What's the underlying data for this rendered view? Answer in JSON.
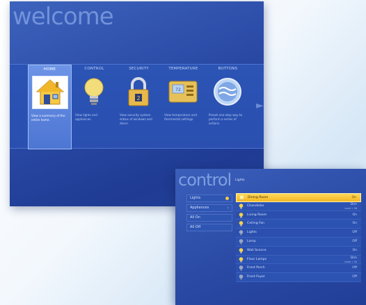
{
  "welcome": {
    "title": "welcome",
    "tiles": [
      {
        "label": "HOME",
        "icon": "house-icon",
        "desc": "View a summary of the entire home.",
        "active": true
      },
      {
        "label": "CONTROL",
        "icon": "lightbulb-icon",
        "desc": "View lights and appliances.",
        "active": false
      },
      {
        "label": "SECURITY",
        "icon": "padlock-icon",
        "desc": "View security system status of windows and doors.",
        "active": false
      },
      {
        "label": "TEMPERATURE",
        "icon": "thermostat-icon",
        "desc": "View temperature and thermostat settings.",
        "active": false
      },
      {
        "label": "BUTTONS",
        "icon": "buttons-icon",
        "desc": "Preset one-step way to perform a series of actions.",
        "active": false
      }
    ],
    "next_arrow": "chevron-right-icon"
  },
  "control": {
    "title": "control",
    "breadcrumb": "Lights",
    "menu": [
      {
        "label": "Lights",
        "marker": "dot"
      },
      {
        "label": "Appliances",
        "marker": "chevron"
      },
      {
        "label": "All On",
        "marker": ""
      },
      {
        "label": "All Off",
        "marker": ""
      }
    ],
    "devices": [
      {
        "name": "Dining Room",
        "state": "On",
        "sub": "",
        "icon": "lightbulb-on-icon",
        "selected": true
      },
      {
        "name": "Chandelier",
        "state": "Dim",
        "sub": "Level = 56",
        "icon": "lightbulb-on-icon",
        "selected": false
      },
      {
        "name": "Living Room",
        "state": "On",
        "sub": "",
        "icon": "lightbulb-on-icon",
        "selected": false
      },
      {
        "name": "Ceiling Fan",
        "state": "On",
        "sub": "",
        "icon": "lightbulb-on-icon",
        "selected": false
      },
      {
        "name": "Lights",
        "state": "Off",
        "sub": "",
        "icon": "lightbulb-off-icon",
        "selected": false
      },
      {
        "name": "Lamp",
        "state": "Off",
        "sub": "",
        "icon": "lightbulb-off-icon",
        "selected": false
      },
      {
        "name": "Wall Sconce",
        "state": "On",
        "sub": "",
        "icon": "lightbulb-on-icon",
        "selected": false
      },
      {
        "name": "Floor Lamps",
        "state": "Dim",
        "sub": "Level = 50",
        "icon": "lightbulb-on-icon",
        "selected": false
      },
      {
        "name": "Front Porch",
        "state": "Off",
        "sub": "",
        "icon": "lightbulb-off-icon",
        "selected": false
      },
      {
        "name": "Front Foyer",
        "state": "Off",
        "sub": "",
        "icon": "lightbulb-off-icon",
        "selected": false
      }
    ]
  },
  "colors": {
    "panel_blue": "#2a4aa6",
    "highlight_yellow": "#f4b623",
    "active_tile": "#5a82dc"
  }
}
